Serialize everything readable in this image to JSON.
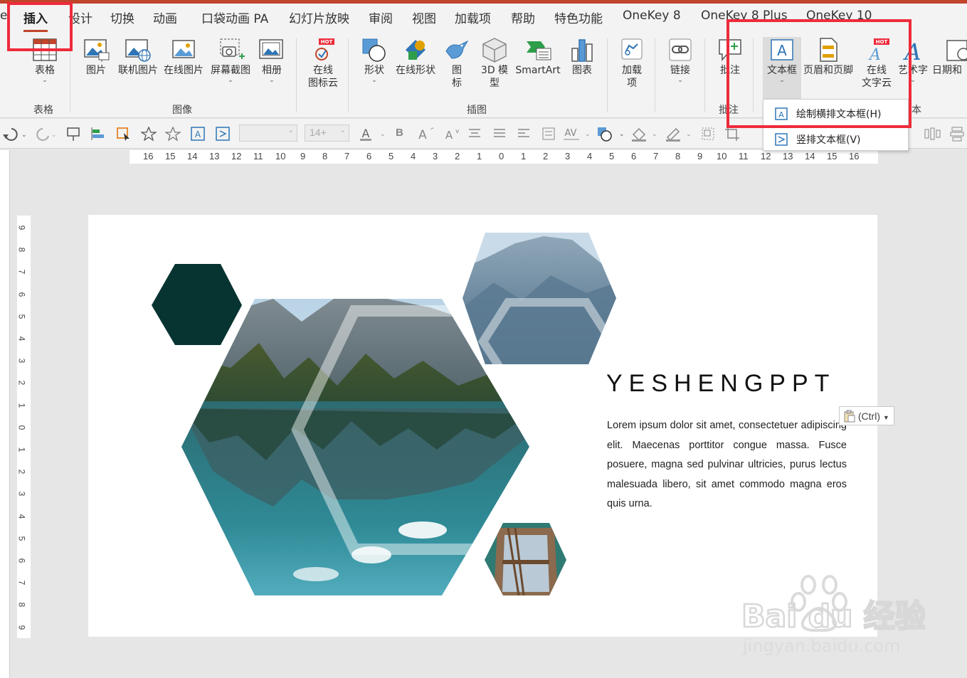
{
  "tabs": {
    "partial_left": "e",
    "insert": "插入",
    "design": "设计",
    "transitions": "切换",
    "animations": "动画",
    "pocket_animation": "口袋动画 PA",
    "slideshow": "幻灯片放映",
    "review": "审阅",
    "view": "视图",
    "addins": "加载项",
    "help": "帮助",
    "special": "特色功能",
    "onekey8": "OneKey 8",
    "onekey8plus": "OneKey 8 Plus",
    "onekey10": "OneKey 10"
  },
  "ribbon": {
    "table": "表格",
    "picture": "图片",
    "online_picture": "联机图片",
    "online_picture2": "在线图片",
    "screenshot": "屏幕截图",
    "album": "相册",
    "online_icons_line1": "在线",
    "online_icons_line2": "图标云",
    "shapes": "形状",
    "online_shapes": "在线形状",
    "icons_line1": "图",
    "icons_line2": "标",
    "model3d_line1": "3D 模",
    "model3d_line2": "型",
    "smartart": "SmartArt",
    "chart": "图表",
    "addin_line1": "加载",
    "addin_line2": "项",
    "link": "链接",
    "comment": "批注",
    "textbox": "文本框",
    "header_footer": "页眉和页脚",
    "online_text_line1": "在线",
    "online_text_line2": "文字云",
    "wordart": "艺术字",
    "datetime": "日期和",
    "hot_badge": "HOT",
    "groups": {
      "tables": "表格",
      "images": "图像",
      "illustrations": "插图",
      "comments": "批注",
      "text_partial": "本"
    }
  },
  "qat": {
    "font_size_placeholder": "14+",
    "bold": "B"
  },
  "rulers": {
    "horizontal": [
      "16",
      "15",
      "14",
      "13",
      "12",
      "11",
      "10",
      "9",
      "8",
      "7",
      "6",
      "5",
      "4",
      "3",
      "2",
      "1",
      "0",
      "1",
      "2",
      "3",
      "4",
      "5",
      "6",
      "7",
      "8",
      "9",
      "10",
      "11",
      "12",
      "13",
      "14",
      "15",
      "16"
    ],
    "vertical": [
      "9",
      "8",
      "7",
      "6",
      "5",
      "4",
      "3",
      "2",
      "1",
      "0",
      "1",
      "2",
      "3",
      "4",
      "5",
      "6",
      "7",
      "8",
      "9"
    ]
  },
  "slide": {
    "title": "YESHENGPPT",
    "body": "Lorem ipsum dolor sit amet, consectetuer adipiscing elit. Maecenas porttitor congue massa. Fusce posuere, magna sed pulvinar ultricies, purus lectus malesuada libero, sit amet commodo magna eros quis urna.",
    "hex_color": "#073431"
  },
  "paste_options": "(Ctrl)",
  "dropdown": {
    "horizontal_textbox": "绘制横排文本框(H)",
    "vertical_textbox": "竖排文本框(V)"
  },
  "watermark": {
    "brand": "Bai du 经验",
    "url": "jingyan.baidu.com"
  },
  "colors": {
    "accent": "#c0452b",
    "highlight": "#ee2b3b",
    "office_blue": "#2e75b6"
  }
}
